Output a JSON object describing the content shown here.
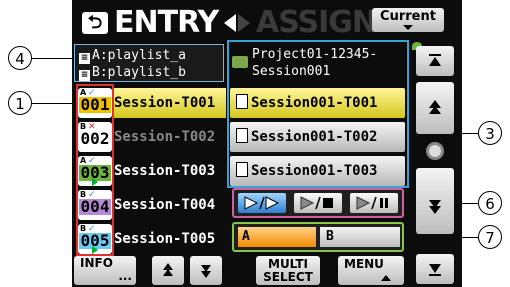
{
  "header": {
    "back_icon": "return-arrow-icon",
    "tab_entry": "ENTRY",
    "tab_assign": "ASSIGN",
    "current_label": "Current"
  },
  "playlists": {
    "a_label": "A:playlist_a",
    "b_label": "B:playlist_b"
  },
  "project": {
    "line1": "Project01-12345-",
    "line2": "Session001"
  },
  "rows": [
    {
      "num": "001",
      "badge_top": "A",
      "badge_mark": "✓",
      "badge_color": "#f0c000",
      "source": "Session-T001",
      "source_state": "highlight",
      "dest": "Session001-T001",
      "dest_state": "highlight"
    },
    {
      "num": "002",
      "badge_top": "B",
      "badge_mark": "✕",
      "badge_color": "#ffffff",
      "source": "Session-T002",
      "source_state": "dim",
      "dest": "Session001-T002",
      "dest_state": "normal"
    },
    {
      "num": "003",
      "badge_top": "A",
      "badge_mark": "✓",
      "badge_color": "#6db33f",
      "source": "Session-T003",
      "source_state": "normal",
      "dest": "Session001-T003",
      "dest_state": "normal"
    },
    {
      "num": "004",
      "badge_top": "B",
      "badge_mark": "✓",
      "badge_color": "#9b5fc0",
      "source": "Session-T004",
      "source_state": "normal",
      "dest": "",
      "dest_state": "none"
    },
    {
      "num": "005",
      "badge_top": "B",
      "badge_mark": "✓",
      "badge_color": "#2fa6e0",
      "source": "Session-T005",
      "source_state": "normal",
      "dest": "",
      "dest_state": "none"
    }
  ],
  "play_modes": [
    "continuous",
    "single",
    "single-pause"
  ],
  "ab": {
    "a": "A",
    "b": "B"
  },
  "bottom": {
    "info": "INFO",
    "info_sub": "...",
    "multi_select_1": "MULTI",
    "multi_select_2": "SELECT",
    "menu": "MENU"
  },
  "callouts": [
    "1",
    "3",
    "4",
    "6",
    "7"
  ],
  "colors": {
    "highlight": "#f0e040",
    "playlist_border": "#7bb4e0",
    "badge_border": "#e03030",
    "play_mode_border": "#d05fa0",
    "ab_border": "#8ac54b",
    "active_play_mode": "#2f7fd0"
  }
}
